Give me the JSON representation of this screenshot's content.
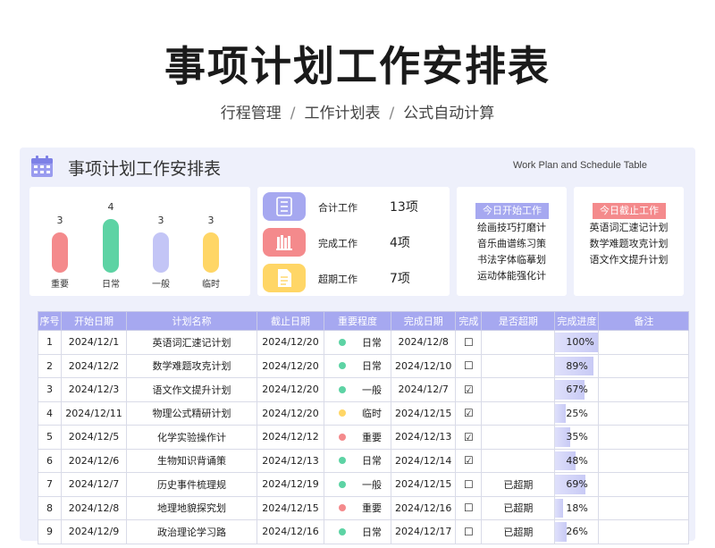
{
  "header": {
    "title": "事项计划工作安排表",
    "subtitle_parts": [
      "行程管理",
      "工作计划表",
      "公式自动计算"
    ],
    "separator": "/"
  },
  "panel": {
    "title": "事项计划工作安排表",
    "title_en": "Work Plan and Schedule Table"
  },
  "chart_data": {
    "type": "bar",
    "categories": [
      "重要",
      "日常",
      "一般",
      "临时"
    ],
    "values": [
      3,
      4,
      3,
      3
    ],
    "colors": [
      "#f48a8c",
      "#5dd3a4",
      "#c3c5f6",
      "#ffd666"
    ]
  },
  "stats": [
    {
      "label": "合计工作",
      "value": "13项",
      "color": "#a6a8f0",
      "icon": "list-icon"
    },
    {
      "label": "完成工作",
      "value": "4项",
      "color": "#f48a8c",
      "icon": "books-icon"
    },
    {
      "label": "超期工作",
      "value": "7项",
      "color": "#ffd666",
      "icon": "document-icon"
    }
  ],
  "today_start": {
    "title": "今日开始工作",
    "color": "#a6a8f0",
    "items": [
      "绘画技巧打磨计",
      "音乐曲谱练习策",
      "书法字体临摹划",
      "运动体能强化计"
    ]
  },
  "today_due": {
    "title": "今日截止工作",
    "color": "#f48a8c",
    "items": [
      "英语词汇速记计划",
      "数学难题攻克计划",
      "语文作文提升计划"
    ]
  },
  "table": {
    "headers": [
      "序号",
      "开始日期",
      "计划名称",
      "截止日期",
      "重要程度",
      "完成日期",
      "完成",
      "是否超期",
      "完成进度",
      "备注"
    ],
    "level_colors": {
      "日常": "#5dd3a4",
      "一般": "#5dd3a4",
      "临时": "#ffd666",
      "重要": "#f48a8c"
    },
    "rows": [
      {
        "no": "1",
        "start": "2024/12/1",
        "name": "英语词汇速记计划",
        "due": "2024/12/20",
        "level": "日常",
        "done_date": "2024/12/8",
        "done": "☐",
        "overdue": "",
        "progress": "100%",
        "pct": 100,
        "note": ""
      },
      {
        "no": "2",
        "start": "2024/12/2",
        "name": "数学难题攻克计划",
        "due": "2024/12/20",
        "level": "日常",
        "done_date": "2024/12/10",
        "done": "☐",
        "overdue": "",
        "progress": "89%",
        "pct": 89,
        "note": ""
      },
      {
        "no": "3",
        "start": "2024/12/3",
        "name": "语文作文提升计划",
        "due": "2024/12/20",
        "level": "一般",
        "done_date": "2024/12/7",
        "done": "☑",
        "overdue": "",
        "progress": "67%",
        "pct": 67,
        "note": ""
      },
      {
        "no": "4",
        "start": "2024/12/11",
        "name": "物理公式精研计划",
        "due": "2024/12/20",
        "level": "临时",
        "done_date": "2024/12/15",
        "done": "☑",
        "overdue": "",
        "progress": "25%",
        "pct": 25,
        "note": ""
      },
      {
        "no": "5",
        "start": "2024/12/5",
        "name": "化学实验操作计",
        "due": "2024/12/12",
        "level": "重要",
        "done_date": "2024/12/13",
        "done": "☑",
        "overdue": "",
        "progress": "35%",
        "pct": 35,
        "note": ""
      },
      {
        "no": "6",
        "start": "2024/12/6",
        "name": "生物知识背诵策",
        "due": "2024/12/13",
        "level": "日常",
        "done_date": "2024/12/14",
        "done": "☑",
        "overdue": "",
        "progress": "48%",
        "pct": 48,
        "note": ""
      },
      {
        "no": "7",
        "start": "2024/12/7",
        "name": "历史事件梳理规",
        "due": "2024/12/19",
        "level": "一般",
        "done_date": "2024/12/15",
        "done": "☐",
        "overdue": "已超期",
        "progress": "69%",
        "pct": 69,
        "note": ""
      },
      {
        "no": "8",
        "start": "2024/12/8",
        "name": "地理地貌探究划",
        "due": "2024/12/15",
        "level": "重要",
        "done_date": "2024/12/16",
        "done": "☐",
        "overdue": "已超期",
        "progress": "18%",
        "pct": 18,
        "note": ""
      },
      {
        "no": "9",
        "start": "2024/12/9",
        "name": "政治理论学习路",
        "due": "2024/12/16",
        "level": "日常",
        "done_date": "2024/12/17",
        "done": "☐",
        "overdue": "已超期",
        "progress": "26%",
        "pct": 26,
        "note": ""
      }
    ]
  }
}
